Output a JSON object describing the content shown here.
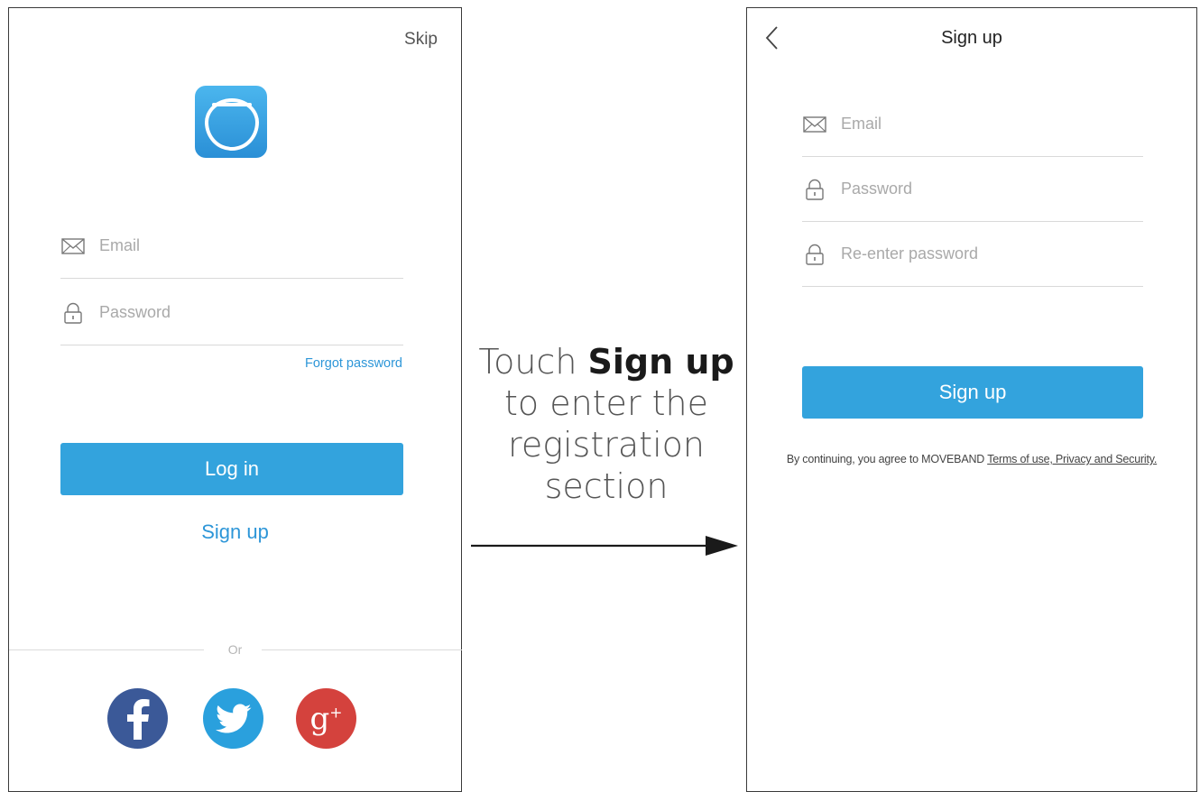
{
  "login_screen": {
    "skip_label": "Skip",
    "email_placeholder": "Email",
    "password_placeholder": "Password",
    "forgot_label": "Forgot password",
    "login_button_label": "Log in",
    "signup_link_label": "Sign up",
    "or_label": "Or",
    "social": {
      "facebook_icon": "facebook-icon",
      "twitter_icon": "twitter-icon",
      "google_icon": "google-plus-icon",
      "google_label": "g",
      "google_sup": "+"
    }
  },
  "caption": {
    "prefix": "Touch",
    "bold": "Sign up",
    "rest1": "to enter the",
    "rest2": "registration",
    "rest3": "section"
  },
  "signup_screen": {
    "title": "Sign up",
    "email_placeholder": "Email",
    "password_placeholder": "Password",
    "reenter_placeholder": "Re-enter password",
    "signup_button_label": "Sign up",
    "terms_prefix": "By continuing, you agree to MOVEBAND",
    "terms_link": "Terms of use, Privacy and Security."
  },
  "colors": {
    "accent": "#33a3dd",
    "link": "#2d96d8",
    "facebook": "#3b5998",
    "twitter": "#2aa0dd",
    "google": "#d4423d"
  }
}
